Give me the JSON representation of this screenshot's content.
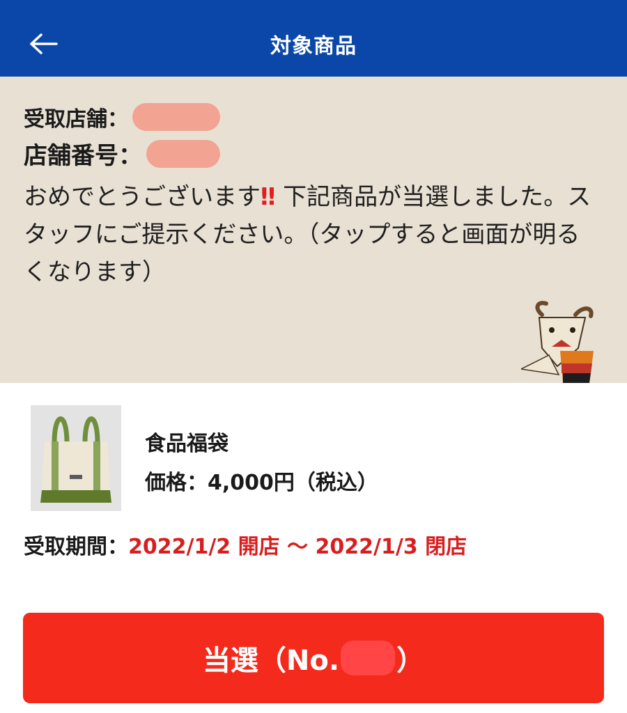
{
  "header": {
    "title": "対象商品",
    "back_icon": "arrow-left-icon",
    "background_color": "#0b47a8"
  },
  "notice": {
    "store_label": "受取店舗：",
    "store_number_label": "店舗番号：",
    "message_part1": "おめでとうございます",
    "emphasis": "‼",
    "message_part2": " 下記商品が当選しました。スタッフにご提示ください。（タップすると画面が明るくなります）",
    "background_color": "#e7e0d3"
  },
  "product": {
    "name": "食品福袋",
    "price": "価格：4,000円（税込）",
    "image_icon": "tote-bag-image",
    "period_label": "受取期間：",
    "period_value": "2022/1/2 開店 〜 2022/1/3 閉店",
    "period_color": "#d81e1e"
  },
  "action": {
    "label_prefix": "当選（No.",
    "label_suffix": "）",
    "color": "#f32a1c"
  }
}
